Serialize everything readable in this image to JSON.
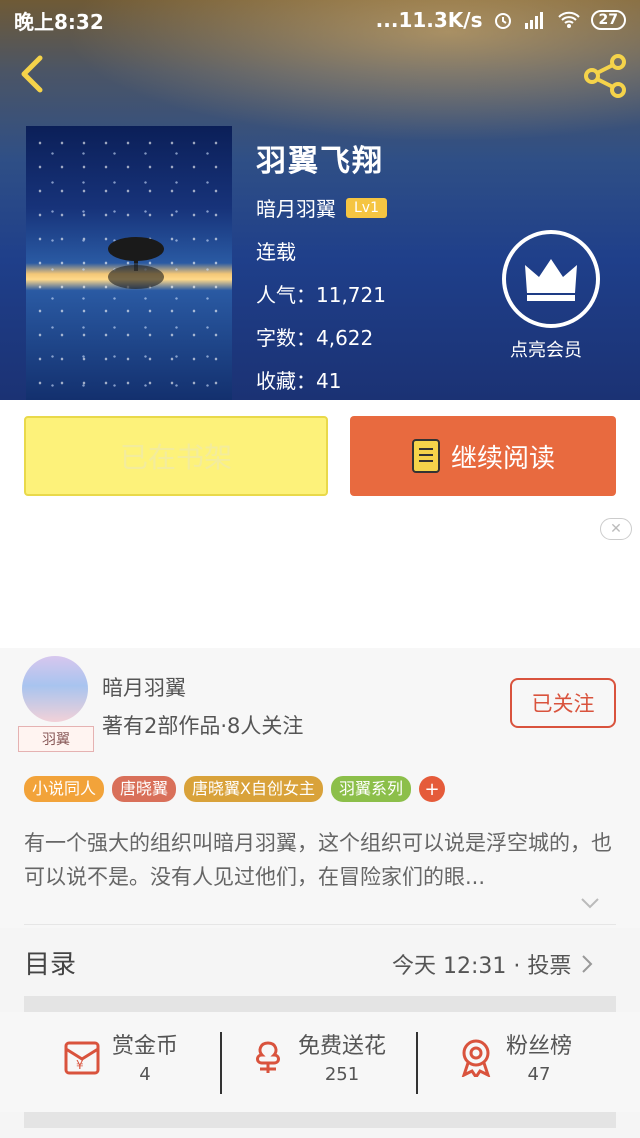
{
  "status_bar": {
    "time": "晚上8:32",
    "network": "...11.3K/s",
    "battery": "27"
  },
  "book": {
    "title": "羽翼飞翔",
    "author": "暗月羽翼",
    "level": "Lv1",
    "status": "连载",
    "popularity": "人气：11,721",
    "word_count": "字数：4,622",
    "favorites": "收藏：41"
  },
  "vip": {
    "label": "点亮会员"
  },
  "buttons": {
    "shelf": "已在书架",
    "read": "继续阅读"
  },
  "author_card": {
    "name": "暗月羽翼",
    "meta": "著有2部作品·8人关注",
    "avatar_tag": "羽翼",
    "follow": "已关注"
  },
  "tags": [
    {
      "label": "小说同人",
      "color": "#f2a33a"
    },
    {
      "label": "唐晓翼",
      "color": "#d9705a"
    },
    {
      "label": "唐晓翼X自创女主",
      "color": "#d9a23a"
    },
    {
      "label": "羽翼系列",
      "color": "#8cbf4a"
    }
  ],
  "summary": "有一个强大的组织叫暗月羽翼，这个组织可以说是浮空城的，也可以说不是。没有人见过他们，在冒险家们的眼...",
  "catalog": {
    "label": "目录",
    "updated": "今天 12:31 · 投票"
  },
  "stats": [
    {
      "label": "赏金币",
      "value": "4"
    },
    {
      "label": "免费送花",
      "value": "251"
    },
    {
      "label": "粉丝榜",
      "value": "47"
    }
  ],
  "colors": {
    "accent": "#e86a3f",
    "shelf_yellow": "#fdf27a",
    "follow_red": "#d9533d"
  }
}
